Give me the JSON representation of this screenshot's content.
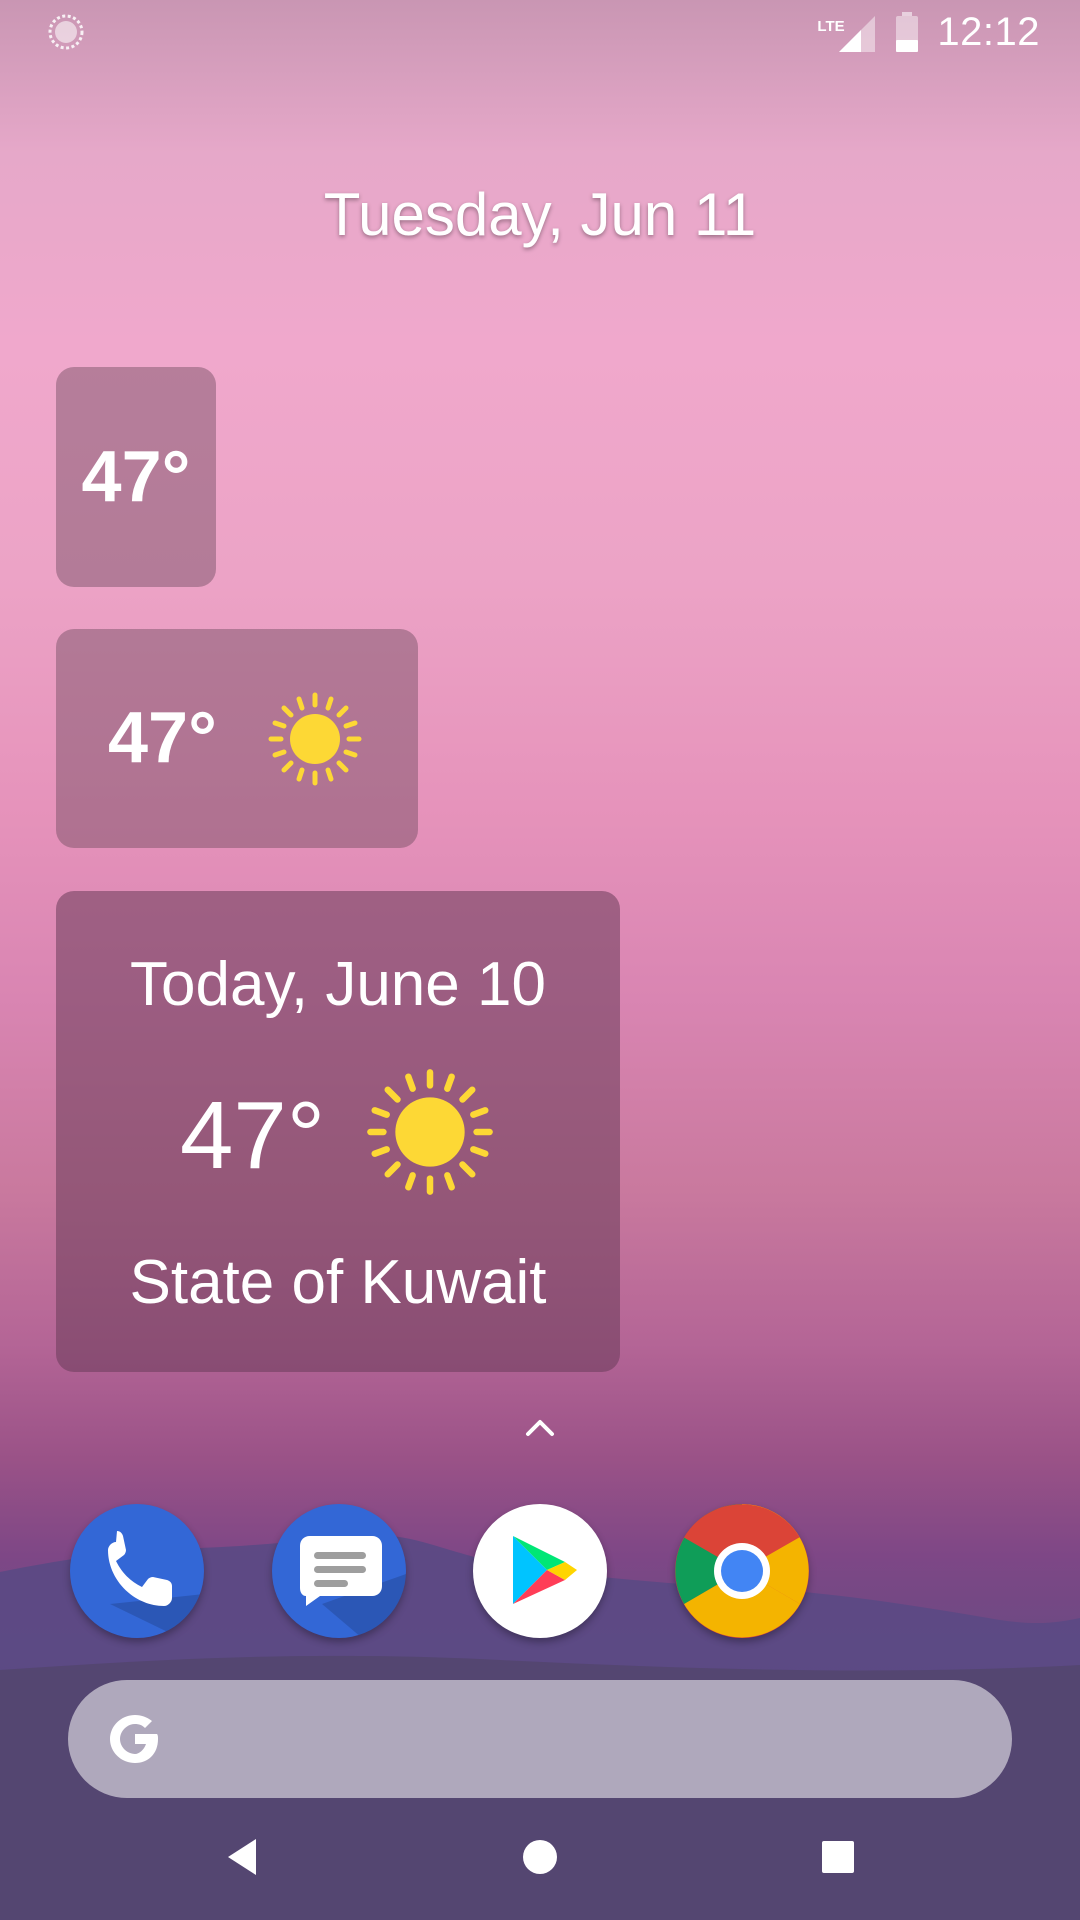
{
  "status_bar": {
    "network_type": "LTE",
    "time": "12:12"
  },
  "home": {
    "date": "Tuesday, Jun 11"
  },
  "widgets": {
    "small": {
      "temp": "47°"
    },
    "medium": {
      "temp": "47°",
      "icon": "sun-icon"
    },
    "large": {
      "day": "Today, June 10",
      "temp": "47°",
      "icon": "sun-icon",
      "location": "State of Kuwait"
    }
  },
  "dock": {
    "apps": [
      "Phone",
      "Messages",
      "Play Store",
      "Chrome"
    ]
  },
  "search": {
    "icon": "google-g-icon"
  },
  "nav": {
    "buttons": [
      "back",
      "home",
      "recents"
    ]
  },
  "colors": {
    "sun": "#FDD835",
    "phone_blue": "#3367D6",
    "chrome_red": "#DB4437",
    "chrome_green": "#0F9D58",
    "chrome_yellow": "#F4B400",
    "chrome_blue": "#4285F4"
  }
}
